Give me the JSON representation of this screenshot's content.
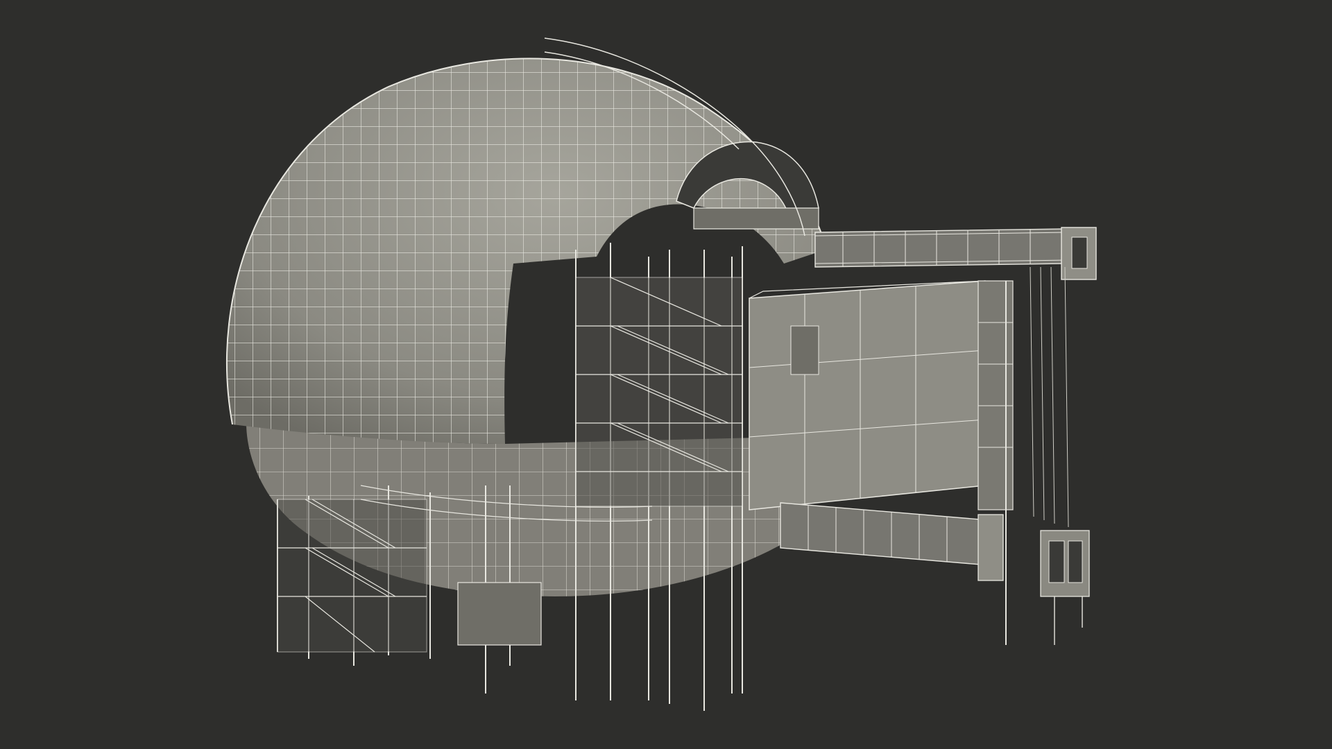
{
  "scene": {
    "subject": "wireframe-render-dome-building",
    "colors": {
      "background": "#2e2e2c",
      "surface": "#8b8a82",
      "surface_light": "#a3a29a",
      "surface_dark": "#6f6e67",
      "wire": "#e8e7e0",
      "interior": "#3a3a37"
    }
  }
}
